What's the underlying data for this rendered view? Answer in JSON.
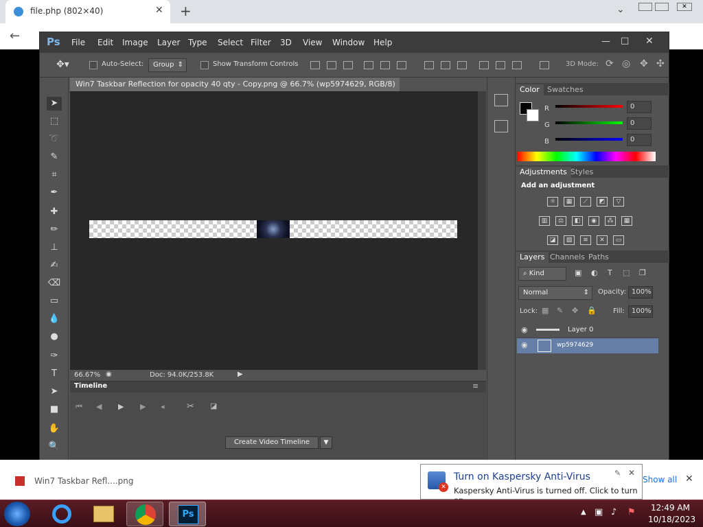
{
  "browser": {
    "tab_title": "file.php (802×40)",
    "download_item": "Win7 Taskbar Refl....png",
    "show_all": "Show all"
  },
  "photoshop": {
    "app_logo": "Ps",
    "menu": [
      "File",
      "Edit",
      "Image",
      "Layer",
      "Type",
      "Select",
      "Filter",
      "3D",
      "View",
      "Window",
      "Help"
    ],
    "options": {
      "auto_select": "Auto-Select:",
      "group_value": "Group",
      "show_transform": "Show Transform Controls",
      "mode_3d": "3D Mode:"
    },
    "doc_tab": "Win7 Taskbar Reflection  for opacity 40 qty  - Copy.png @ 66.7% (wp5974629, RGB/8) *",
    "zoom": "66.67%",
    "doc_size": "Doc: 94.0K/253.8K",
    "timeline": {
      "title": "Timeline",
      "create_button": "Create Video Timeline"
    },
    "color_panel": {
      "tabs": [
        "Color",
        "Swatches"
      ],
      "r_label": "R",
      "g_label": "G",
      "b_label": "B",
      "r": "0",
      "g": "0",
      "b": "0"
    },
    "adjustments_panel": {
      "tabs": [
        "Adjustments",
        "Styles"
      ],
      "heading": "Add an adjustment"
    },
    "layers_panel": {
      "tabs": [
        "Layers",
        "Channels",
        "Paths"
      ],
      "kind": "Kind",
      "blend": "Normal",
      "opacity_label": "Opacity:",
      "opacity": "100%",
      "lock_label": "Lock:",
      "fill_label": "Fill:",
      "fill": "100%",
      "layers": [
        "Layer 0",
        "wp5974629"
      ]
    }
  },
  "notification": {
    "title": "Turn on Kaspersky Anti-Virus",
    "body": "Kaspersky Anti-Virus is turned off. Click to turn on."
  },
  "taskbar": {
    "time": "12:49 AM",
    "date": "10/18/2023"
  }
}
